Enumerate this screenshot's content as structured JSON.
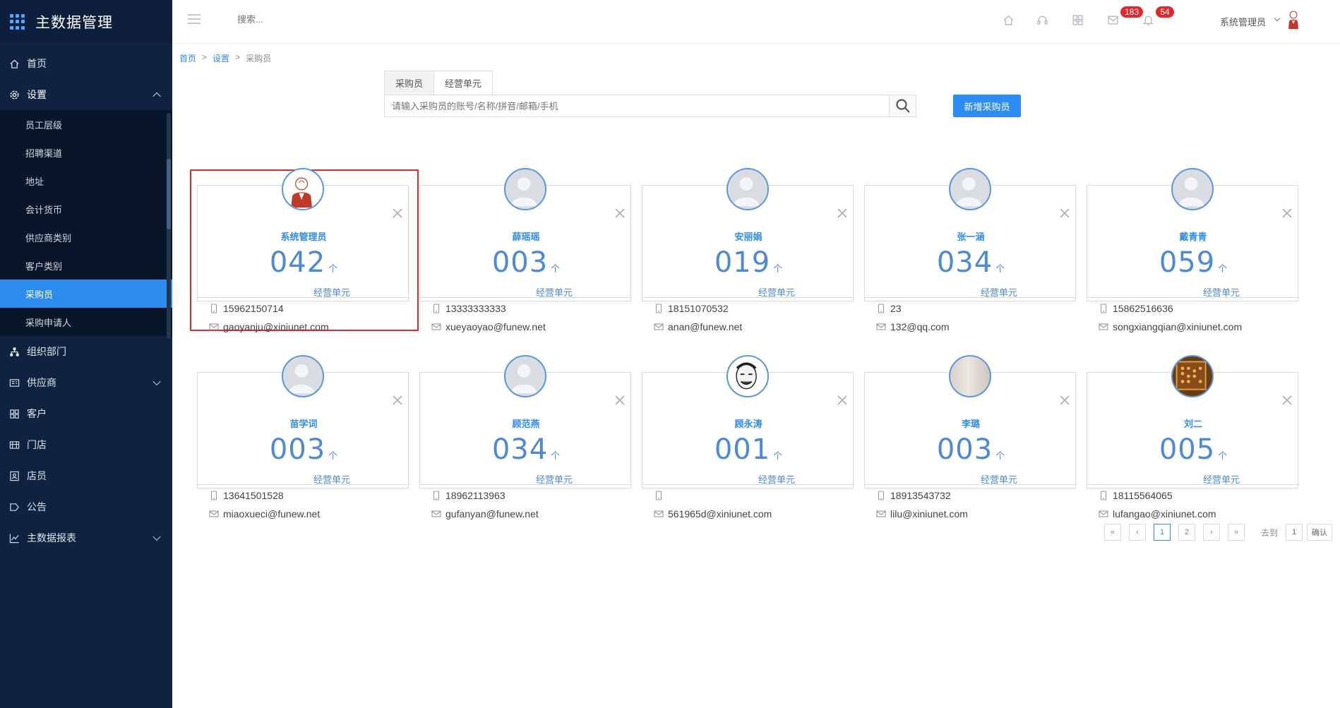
{
  "app": {
    "title": "主数据管理"
  },
  "sidebar": {
    "items": [
      {
        "label": "首页",
        "icon": "home-icon"
      },
      {
        "label": "设置",
        "icon": "gear-icon",
        "open": true
      },
      {
        "label": "组织部门",
        "icon": "org-icon"
      },
      {
        "label": "供应商",
        "icon": "supplier-icon"
      },
      {
        "label": "客户",
        "icon": "customer-icon"
      },
      {
        "label": "门店",
        "icon": "store-icon"
      },
      {
        "label": "店员",
        "icon": "clerk-icon"
      },
      {
        "label": "公告",
        "icon": "notice-icon"
      },
      {
        "label": "主数据报表",
        "icon": "chart-icon"
      }
    ],
    "settings_submenu": [
      "员工层级",
      "招聘渠道",
      "地址",
      "会计货币",
      "供应商类别",
      "客户类别",
      "采购员",
      "采购申请人"
    ],
    "active_submenu": "采购员"
  },
  "topbar": {
    "search_placeholder": "搜索...",
    "badges": {
      "messages": "183",
      "notifications": "54"
    },
    "user_name": "系统管理员"
  },
  "breadcrumb": {
    "home": "首页",
    "settings": "设置",
    "current": "采购员",
    "sep": ">"
  },
  "tabs": [
    "采购员",
    "经营单元"
  ],
  "search": {
    "placeholder": "请输入采购员的账号/名称/拼音/邮箱/手机"
  },
  "add_button": "新增采购员",
  "card_common": {
    "unit_suffix": "个",
    "unit_link": "经营单元"
  },
  "buyers": [
    {
      "name": "系统管理员",
      "count": "042",
      "phone": "15962150714",
      "email": "gaoyanju@xiniunet.com",
      "avatar": "admin"
    },
    {
      "name": "薛瑶瑶",
      "count": "003",
      "phone": "13333333333",
      "email": "xueyaoyao@funew.net",
      "avatar": "default"
    },
    {
      "name": "安丽娟",
      "count": "019",
      "phone": "18151070532",
      "email": "anan@funew.net",
      "avatar": "default"
    },
    {
      "name": "张一涵",
      "count": "034",
      "phone": "23",
      "email": "132@qq.com",
      "avatar": "default"
    },
    {
      "name": "戴青青",
      "count": "059",
      "phone": "15862516636",
      "email": "songxiangqian@xiniunet.com",
      "avatar": "default"
    },
    {
      "name": "苗学词",
      "count": "003",
      "phone": "13641501528",
      "email": "miaoxueci@funew.net",
      "avatar": "default"
    },
    {
      "name": "顾范燕",
      "count": "034",
      "phone": "18962113963",
      "email": "gufanyan@funew.net",
      "avatar": "default"
    },
    {
      "name": "顾永涛",
      "count": "001",
      "phone": "",
      "email": "561965d@xiniunet.com",
      "avatar": "meme"
    },
    {
      "name": "李璐",
      "count": "003",
      "phone": "18913543732",
      "email": "lilu@xiniunet.com",
      "avatar": "photo"
    },
    {
      "name": "刘二",
      "count": "005",
      "phone": "18115564065",
      "email": "lufangao@xiniunet.com",
      "avatar": "abacus"
    }
  ],
  "pagination": {
    "first": "«",
    "prev": "‹",
    "pages": [
      "1",
      "2"
    ],
    "current": "1",
    "next": "›",
    "last": "»",
    "goto_label": "去到",
    "goto_value": "1",
    "confirm": "确认"
  },
  "colors": {
    "sidebar_bg": "#0f2340",
    "accent": "#2d8cf0",
    "badge": "#e7262c",
    "selection_outline": "#e8262c"
  }
}
